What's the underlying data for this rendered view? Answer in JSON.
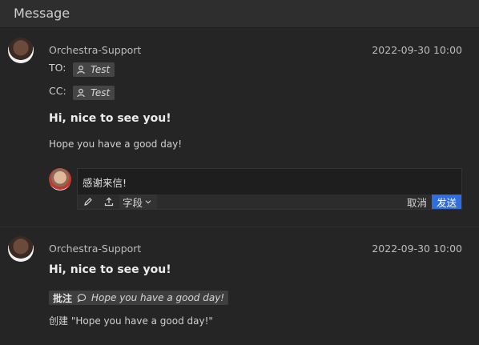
{
  "header": {
    "title": "Message"
  },
  "messages": [
    {
      "sender": "Orchestra-Support",
      "time": "2022-09-30 10:00",
      "to_label": "TO:",
      "to_recipient": "Test",
      "cc_label": "CC:",
      "cc_recipient": "Test",
      "subject": "Hi, nice to see you!",
      "body": "Hope you have a good day!",
      "reply": {
        "value": "感谢来信!",
        "fields_label": "字段",
        "cancel_label": "取消",
        "send_label": "发送"
      }
    },
    {
      "sender": "Orchestra-Support",
      "time": "2022-09-30 10:00",
      "subject": "Hi, nice to see you!",
      "annotation_tag": "批注",
      "annotation_text": "Hope you have a good day!",
      "created_text": "创建 \"Hope you have a good day!\""
    }
  ],
  "colors": {
    "background": "#252525",
    "header": "#2e2e2e",
    "send_button": "#2f6ee0",
    "chip": "#454545"
  },
  "icons": [
    "user-icon",
    "pencil-icon",
    "upload-icon",
    "chevron-down-icon",
    "comment-icon"
  ]
}
